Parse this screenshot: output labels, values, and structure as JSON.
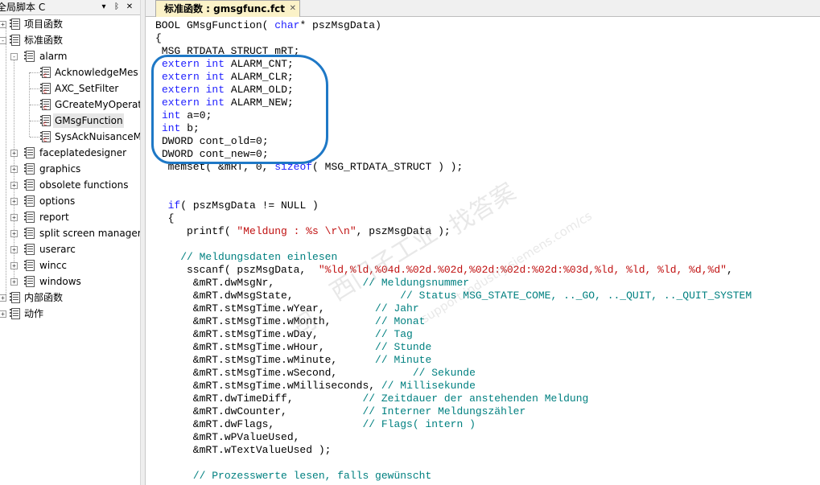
{
  "panel": {
    "title": "全局脚本 C",
    "pin_glyph": "▾",
    "pushpin_glyph": "ᛒ",
    "close_glyph": "✕"
  },
  "tree": [
    {
      "label": "项目函数",
      "level": 0,
      "expander": "+",
      "icon": "script-icon"
    },
    {
      "label": "标准函数",
      "level": 0,
      "expander": "−",
      "icon": "script-icon"
    },
    {
      "label": "alarm",
      "level": 1,
      "expander": "−",
      "icon": "script-icon"
    },
    {
      "label": "AcknowledgeMes",
      "level": 2,
      "expander": "",
      "icon": "script-file-icon"
    },
    {
      "label": "AXC_SetFilter",
      "level": 2,
      "expander": "",
      "icon": "script-file-icon"
    },
    {
      "label": "GCreateMyOperat",
      "level": 2,
      "expander": "",
      "icon": "script-file-icon"
    },
    {
      "label": "GMsgFunction",
      "level": 2,
      "expander": "",
      "icon": "script-file-icon",
      "selected": true
    },
    {
      "label": "SysAckNuisanceM",
      "level": 2,
      "expander": "",
      "icon": "script-file-icon"
    },
    {
      "label": "faceplatedesigner",
      "level": 1,
      "expander": "+",
      "icon": "script-icon"
    },
    {
      "label": "graphics",
      "level": 1,
      "expander": "+",
      "icon": "script-icon"
    },
    {
      "label": "obsolete functions",
      "level": 1,
      "expander": "+",
      "icon": "script-icon"
    },
    {
      "label": "options",
      "level": 1,
      "expander": "+",
      "icon": "script-icon"
    },
    {
      "label": "report",
      "level": 1,
      "expander": "+",
      "icon": "script-icon"
    },
    {
      "label": "split screen manager",
      "level": 1,
      "expander": "+",
      "icon": "script-icon"
    },
    {
      "label": "userarc",
      "level": 1,
      "expander": "+",
      "icon": "script-icon"
    },
    {
      "label": "wincc",
      "level": 1,
      "expander": "+",
      "icon": "script-icon"
    },
    {
      "label": "windows",
      "level": 1,
      "expander": "+",
      "icon": "script-icon"
    },
    {
      "label": "内部函数",
      "level": 0,
      "expander": "+",
      "icon": "script-icon"
    },
    {
      "label": "动作",
      "level": 0,
      "expander": "+",
      "icon": "script-icon"
    }
  ],
  "editor": {
    "tab_label": "标准函数 : gmsgfunc.fct",
    "tab_close": "✕",
    "colors": {
      "keyword": "#1d1dff",
      "string": "#c01010",
      "comment": "#008080",
      "annotation": "#1e78c6"
    },
    "lines": [
      [
        {
          "t": "BOOL GMsgFunction( "
        },
        {
          "t": "char",
          "k": "kw"
        },
        {
          "t": "* pszMsgData)"
        }
      ],
      [
        {
          "t": "{"
        }
      ],
      [
        {
          "t": " MSG_RTDATA_STRUCT mRT;"
        }
      ],
      [
        {
          "t": "extern",
          "k": "kw"
        },
        {
          "t": " "
        },
        {
          "t": "int",
          "k": "kw"
        },
        {
          "t": " ALARM_CNT;"
        }
      ],
      [
        {
          "t": "extern",
          "k": "kw"
        },
        {
          "t": " "
        },
        {
          "t": "int",
          "k": "kw"
        },
        {
          "t": " ALARM_CLR;"
        }
      ],
      [
        {
          "t": "extern",
          "k": "kw"
        },
        {
          "t": " "
        },
        {
          "t": "int",
          "k": "kw"
        },
        {
          "t": " ALARM_OLD;"
        }
      ],
      [
        {
          "t": "extern",
          "k": "kw"
        },
        {
          "t": " "
        },
        {
          "t": "int",
          "k": "kw"
        },
        {
          "t": " ALARM_NEW;"
        }
      ],
      [
        {
          "t": "int",
          "k": "kw"
        },
        {
          "t": " a=0;"
        }
      ],
      [
        {
          "t": "int",
          "k": "kw"
        },
        {
          "t": " b;"
        }
      ],
      [
        {
          "t": "DWORD cont_old=0;"
        }
      ],
      [
        {
          "t": "DWORD cont_new=0;"
        }
      ],
      [
        {
          "t": "  memset( &mRT, 0, "
        },
        {
          "t": "sizeof",
          "k": "kw"
        },
        {
          "t": "( MSG_RTDATA_STRUCT ) );"
        }
      ],
      [
        {
          "t": ""
        }
      ],
      [
        {
          "t": ""
        }
      ],
      [
        {
          "t": "  "
        },
        {
          "t": "if",
          "k": "kw"
        },
        {
          "t": "( pszMsgData != NULL )"
        }
      ],
      [
        {
          "t": "  {"
        }
      ],
      [
        {
          "t": "     printf( "
        },
        {
          "t": "\"Meldung : %s \\r\\n\"",
          "k": "str"
        },
        {
          "t": ", pszMsgData );"
        }
      ],
      [
        {
          "t": ""
        }
      ],
      [
        {
          "t": "    "
        },
        {
          "t": "// Meldungsdaten einlesen",
          "k": "cm"
        }
      ],
      [
        {
          "t": "     sscanf( pszMsgData,  "
        },
        {
          "t": "\"%ld,%ld,%04d.%02d.%02d,%02d:%02d:%02d:%03d,%ld, %ld, %ld, %d,%d\"",
          "k": "str"
        },
        {
          "t": ","
        }
      ],
      [
        {
          "t": "      &mRT.dwMsgNr,              "
        },
        {
          "t": "// Meldungsnummer",
          "k": "cm"
        }
      ],
      [
        {
          "t": "      &mRT.dwMsgState,                 "
        },
        {
          "t": "// Status MSG_STATE_COME, .._GO, .._QUIT, .._QUIT_SYSTEM",
          "k": "cm"
        }
      ],
      [
        {
          "t": "      &mRT.stMsgTime.wYear,        "
        },
        {
          "t": "// Jahr",
          "k": "cm"
        }
      ],
      [
        {
          "t": "      &mRT.stMsgTime.wMonth,       "
        },
        {
          "t": "// Monat",
          "k": "cm"
        }
      ],
      [
        {
          "t": "      &mRT.stMsgTime.wDay,         "
        },
        {
          "t": "// Tag",
          "k": "cm"
        }
      ],
      [
        {
          "t": "      &mRT.stMsgTime.wHour,        "
        },
        {
          "t": "// Stunde",
          "k": "cm"
        }
      ],
      [
        {
          "t": "      &mRT.stMsgTime.wMinute,      "
        },
        {
          "t": "// Minute",
          "k": "cm"
        }
      ],
      [
        {
          "t": "      &mRT.stMsgTime.wSecond,            "
        },
        {
          "t": "// Sekunde",
          "k": "cm"
        }
      ],
      [
        {
          "t": "      &mRT.stMsgTime.wMilliseconds, "
        },
        {
          "t": "// Millisekunde",
          "k": "cm"
        }
      ],
      [
        {
          "t": "      &mRT.dwTimeDiff,           "
        },
        {
          "t": "// Zeitdauer der anstehenden Meldung",
          "k": "cm"
        }
      ],
      [
        {
          "t": "      &mRT.dwCounter,            "
        },
        {
          "t": "// Interner Meldungszähler",
          "k": "cm"
        }
      ],
      [
        {
          "t": "      &mRT.dwFlags,              "
        },
        {
          "t": "// Flags( intern )",
          "k": "cm"
        }
      ],
      [
        {
          "t": "      &mRT.wPValueUsed,"
        }
      ],
      [
        {
          "t": "      &mRT.wTextValueUsed );"
        }
      ],
      [
        {
          "t": ""
        }
      ],
      [
        {
          "t": "      "
        },
        {
          "t": "// Prozesswerte lesen, falls gewünscht",
          "k": "cm"
        }
      ]
    ]
  },
  "watermarks": [
    "找答案",
    "support.industry.siemens.com/cs",
    "西门子工业",
    "司"
  ]
}
